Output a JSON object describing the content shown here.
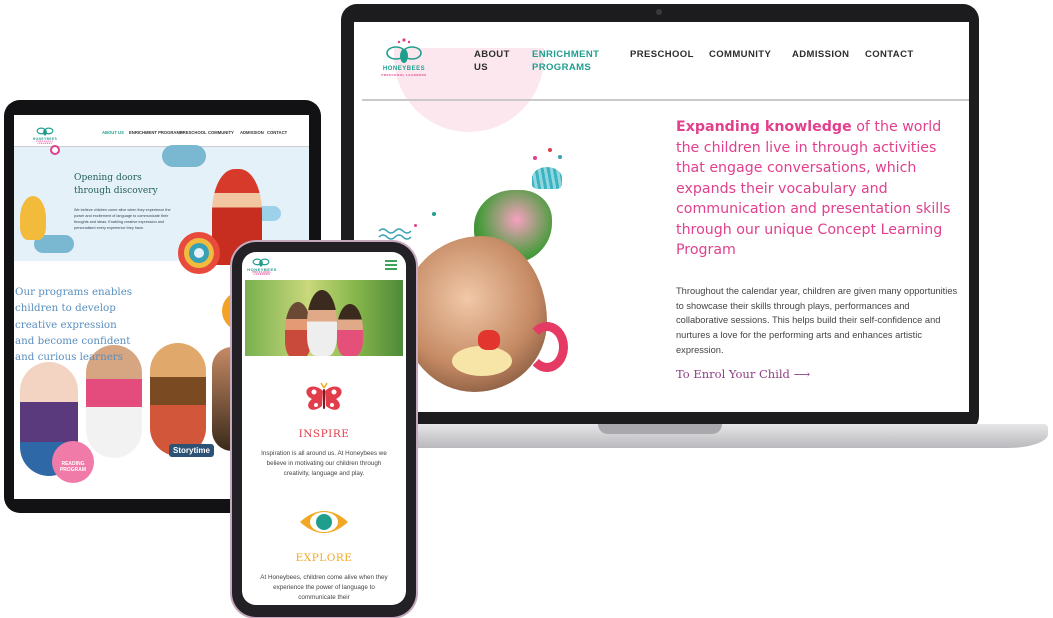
{
  "laptop": {
    "logo": {
      "name": "HONEYBEES",
      "tagline": "PRESCHOOL LEARNERS"
    },
    "nav": [
      {
        "label": "ABOUT\nUS"
      },
      {
        "label": "ENRICHMENT\nPROGRAMS",
        "active": true
      },
      {
        "label": "PRESCHOOL"
      },
      {
        "label": "COMMUNITY"
      },
      {
        "label": "ADMISSION"
      },
      {
        "label": "CONTACT"
      }
    ],
    "headline_bold": "Expanding knowledge",
    "headline_rest": " of the world the children live in through activities that engage conversations, which expands their vocabulary and communication and presentation skills through our unique Concept Learning Program",
    "body": "Throughout the calendar year, children are given many opportunities to showcase their skills through plays, performances and collaborative sessions. This helps build their self-confidence and nurtures a love for the performing arts and enhances artistic expression.",
    "cta": "To Enrol Your Child ⟶"
  },
  "tablet": {
    "logo": {
      "name": "HONEYBEES",
      "tagline": "PRESCHOOL LEARNERS"
    },
    "nav": [
      {
        "label": "ABOUT US",
        "active": true
      },
      {
        "label": "ENRICHMENT PROGRAMS"
      },
      {
        "label": "PRESCHOOL"
      },
      {
        "label": "COMMUNITY"
      },
      {
        "label": "ADMISSION"
      },
      {
        "label": "CONTACT"
      }
    ],
    "hero_title": "Opening doors through discovery",
    "hero_text": "We believe children come alive when they experience the power and excitement of language to communicate their thoughts and ideas. Enabling creative expression and personalised every experience they have.",
    "programs_text": "Our programs enables children to develop creative expression and become confident and curious learners",
    "reading_badge": "READING PROGRAM",
    "storytime": "Storytime"
  },
  "phone": {
    "logo": {
      "name": "HONEYBEES",
      "tagline": "PRESCHOOL LEARNERS"
    },
    "sections": [
      {
        "title": "INSPIRE",
        "text": "Inspiration is all around us. At Honeybees we believe in motivating our children through creativity, language and play.",
        "icon": "butterfly-icon",
        "color": "#e23d4b"
      },
      {
        "title": "EXPLORE",
        "text": "At Honeybees, children come alive when they experience the power of language to communicate their",
        "icon": "eye-icon",
        "color": "#f2a824"
      }
    ]
  },
  "colors": {
    "teal": "#1f9e8e",
    "pink": "#e23f8d",
    "purple": "#8e3f86",
    "red": "#e23d4b",
    "yellow": "#f2a824"
  }
}
